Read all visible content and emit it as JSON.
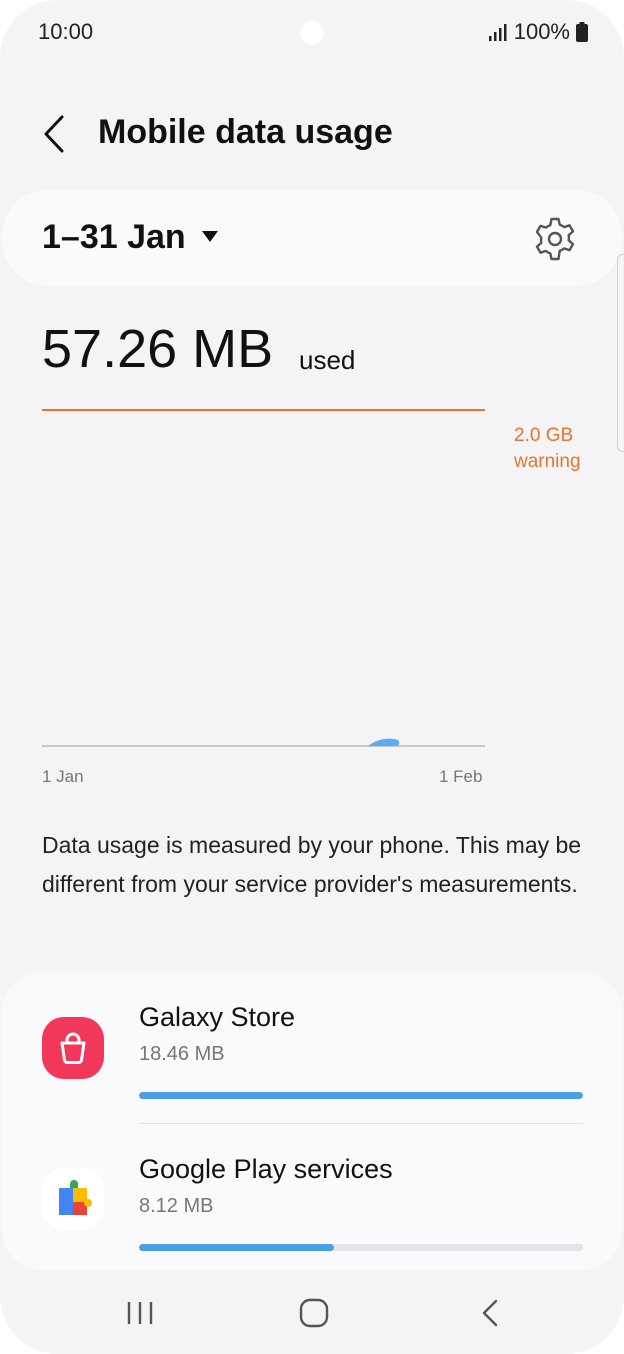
{
  "status": {
    "time": "10:00",
    "battery": "100%"
  },
  "header": {
    "title": "Mobile data usage"
  },
  "period": {
    "label": "1–31 Jan"
  },
  "usage": {
    "amount": "57.26 MB",
    "unit_word": "used"
  },
  "chart": {
    "warning_line1": "2.0 GB",
    "warning_line2": "warning",
    "x_start": "1 Jan",
    "x_end": "1 Feb"
  },
  "info": {
    "text": "Data usage is measured by your phone. This may be different from your service provider's measurements."
  },
  "apps": [
    {
      "name": "Galaxy Store",
      "size": "18.46 MB",
      "fraction": 1.0
    },
    {
      "name": "Google Play services",
      "size": "8.12 MB",
      "fraction": 0.44
    }
  ],
  "colors": {
    "warning": "#e8732f",
    "usage_bar": "#4a9fe6",
    "galaxy_store": "#f2385a"
  },
  "icons": {
    "back": "chevron-left-icon",
    "period_dropdown": "caret-down-icon",
    "settings": "gear-icon",
    "nav_recents": "recents-icon",
    "nav_home": "home-icon",
    "nav_back": "nav-back-icon"
  }
}
